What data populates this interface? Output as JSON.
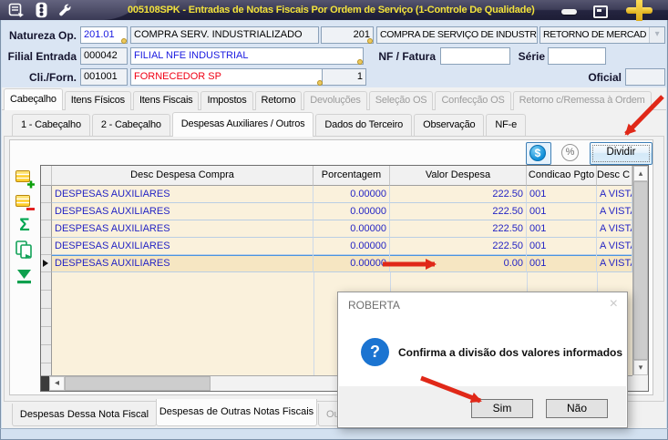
{
  "window": {
    "title": "005108SPK - Entradas de Notas Fiscais Por Ordem de Serviço (1-Controle De Qualidade)"
  },
  "form": {
    "natureza": {
      "label": "Natureza Op.",
      "code": "201.01",
      "desc": "COMPRA SERV. INDUSTRIALIZADO",
      "code2": "201",
      "desc2": "COMPRA DE SERVIÇO DE INDUSTRIAL",
      "tipo": "RETORNO DE MERCAD"
    },
    "filial": {
      "label": "Filial Entrada",
      "code": "000042",
      "desc": "FILIAL NFE INDUSTRIAL"
    },
    "nf": {
      "label": "NF / Fatura",
      "value": ""
    },
    "serie": {
      "label": "Série",
      "value": ""
    },
    "cliforn": {
      "label": "Cli./Forn.",
      "code": "001001",
      "desc": "FORNECEDOR SP",
      "qty": "1"
    },
    "oficial": {
      "label": "Oficial",
      "value": ""
    }
  },
  "tabs_main": [
    {
      "label": "Cabeçalho",
      "state": "active"
    },
    {
      "label": "Itens Físicos",
      "state": "enabled"
    },
    {
      "label": "Itens Fiscais",
      "state": "enabled"
    },
    {
      "label": "Impostos",
      "state": "enabled"
    },
    {
      "label": "Retorno",
      "state": "enabled"
    },
    {
      "label": "Devoluções",
      "state": "disabled"
    },
    {
      "label": "Seleção OS",
      "state": "disabled"
    },
    {
      "label": "Confecção OS",
      "state": "disabled"
    },
    {
      "label": "Retorno c/Remessa à Ordem",
      "state": "disabled"
    }
  ],
  "tabs_sub": [
    {
      "label": "1 - Cabeçalho",
      "state": "enabled"
    },
    {
      "label": "2 - Cabeçalho",
      "state": "enabled"
    },
    {
      "label": "Despesas Auxiliares / Outros",
      "state": "active"
    },
    {
      "label": "Dados do Terceiro",
      "state": "enabled"
    },
    {
      "label": "Observação",
      "state": "enabled"
    },
    {
      "label": "NF-e",
      "state": "enabled"
    }
  ],
  "toolbar": {
    "money_label": "$",
    "percent_label": "%",
    "dividir_label": "Dividir"
  },
  "grid": {
    "columns": [
      "Desc Despesa Compra",
      "Porcentagem",
      "Valor Despesa",
      "Condicao Pgto",
      "Desc C"
    ],
    "rows": [
      {
        "desc": "DESPESAS AUXILIARES",
        "pct": "0.00000",
        "val": "222.50",
        "cond": "001",
        "dsc": "A VISTA"
      },
      {
        "desc": "DESPESAS AUXILIARES",
        "pct": "0.00000",
        "val": "222.50",
        "cond": "001",
        "dsc": "A VISTA"
      },
      {
        "desc": "DESPESAS AUXILIARES",
        "pct": "0.00000",
        "val": "222.50",
        "cond": "001",
        "dsc": "A VISTA"
      },
      {
        "desc": "DESPESAS AUXILIARES",
        "pct": "0.00000",
        "val": "222.50",
        "cond": "001",
        "dsc": "A VISTA"
      },
      {
        "desc": "DESPESAS AUXILIARES",
        "pct": "0.00000",
        "val": "0.00",
        "cond": "001",
        "dsc": "A VISTA"
      }
    ]
  },
  "bottom_tabs": [
    {
      "label": "Despesas Dessa Nota Fiscal",
      "state": "enabled"
    },
    {
      "label": "Despesas de Outras Notas Fiscais",
      "state": "active"
    },
    {
      "label": "Outr",
      "state": "disabled"
    }
  ],
  "dialog": {
    "title": "ROBERTA",
    "message": "Confirma a divisão dos valores informados",
    "yes_label": "Sim",
    "no_label": "Não"
  },
  "colors": {
    "accent_blue": "#1b74d1",
    "arrow_red": "#e02818",
    "grid_row_bg": "#faf1dc",
    "grid_text_blue": "#2424c4",
    "title_yellow": "#f2e23c"
  }
}
